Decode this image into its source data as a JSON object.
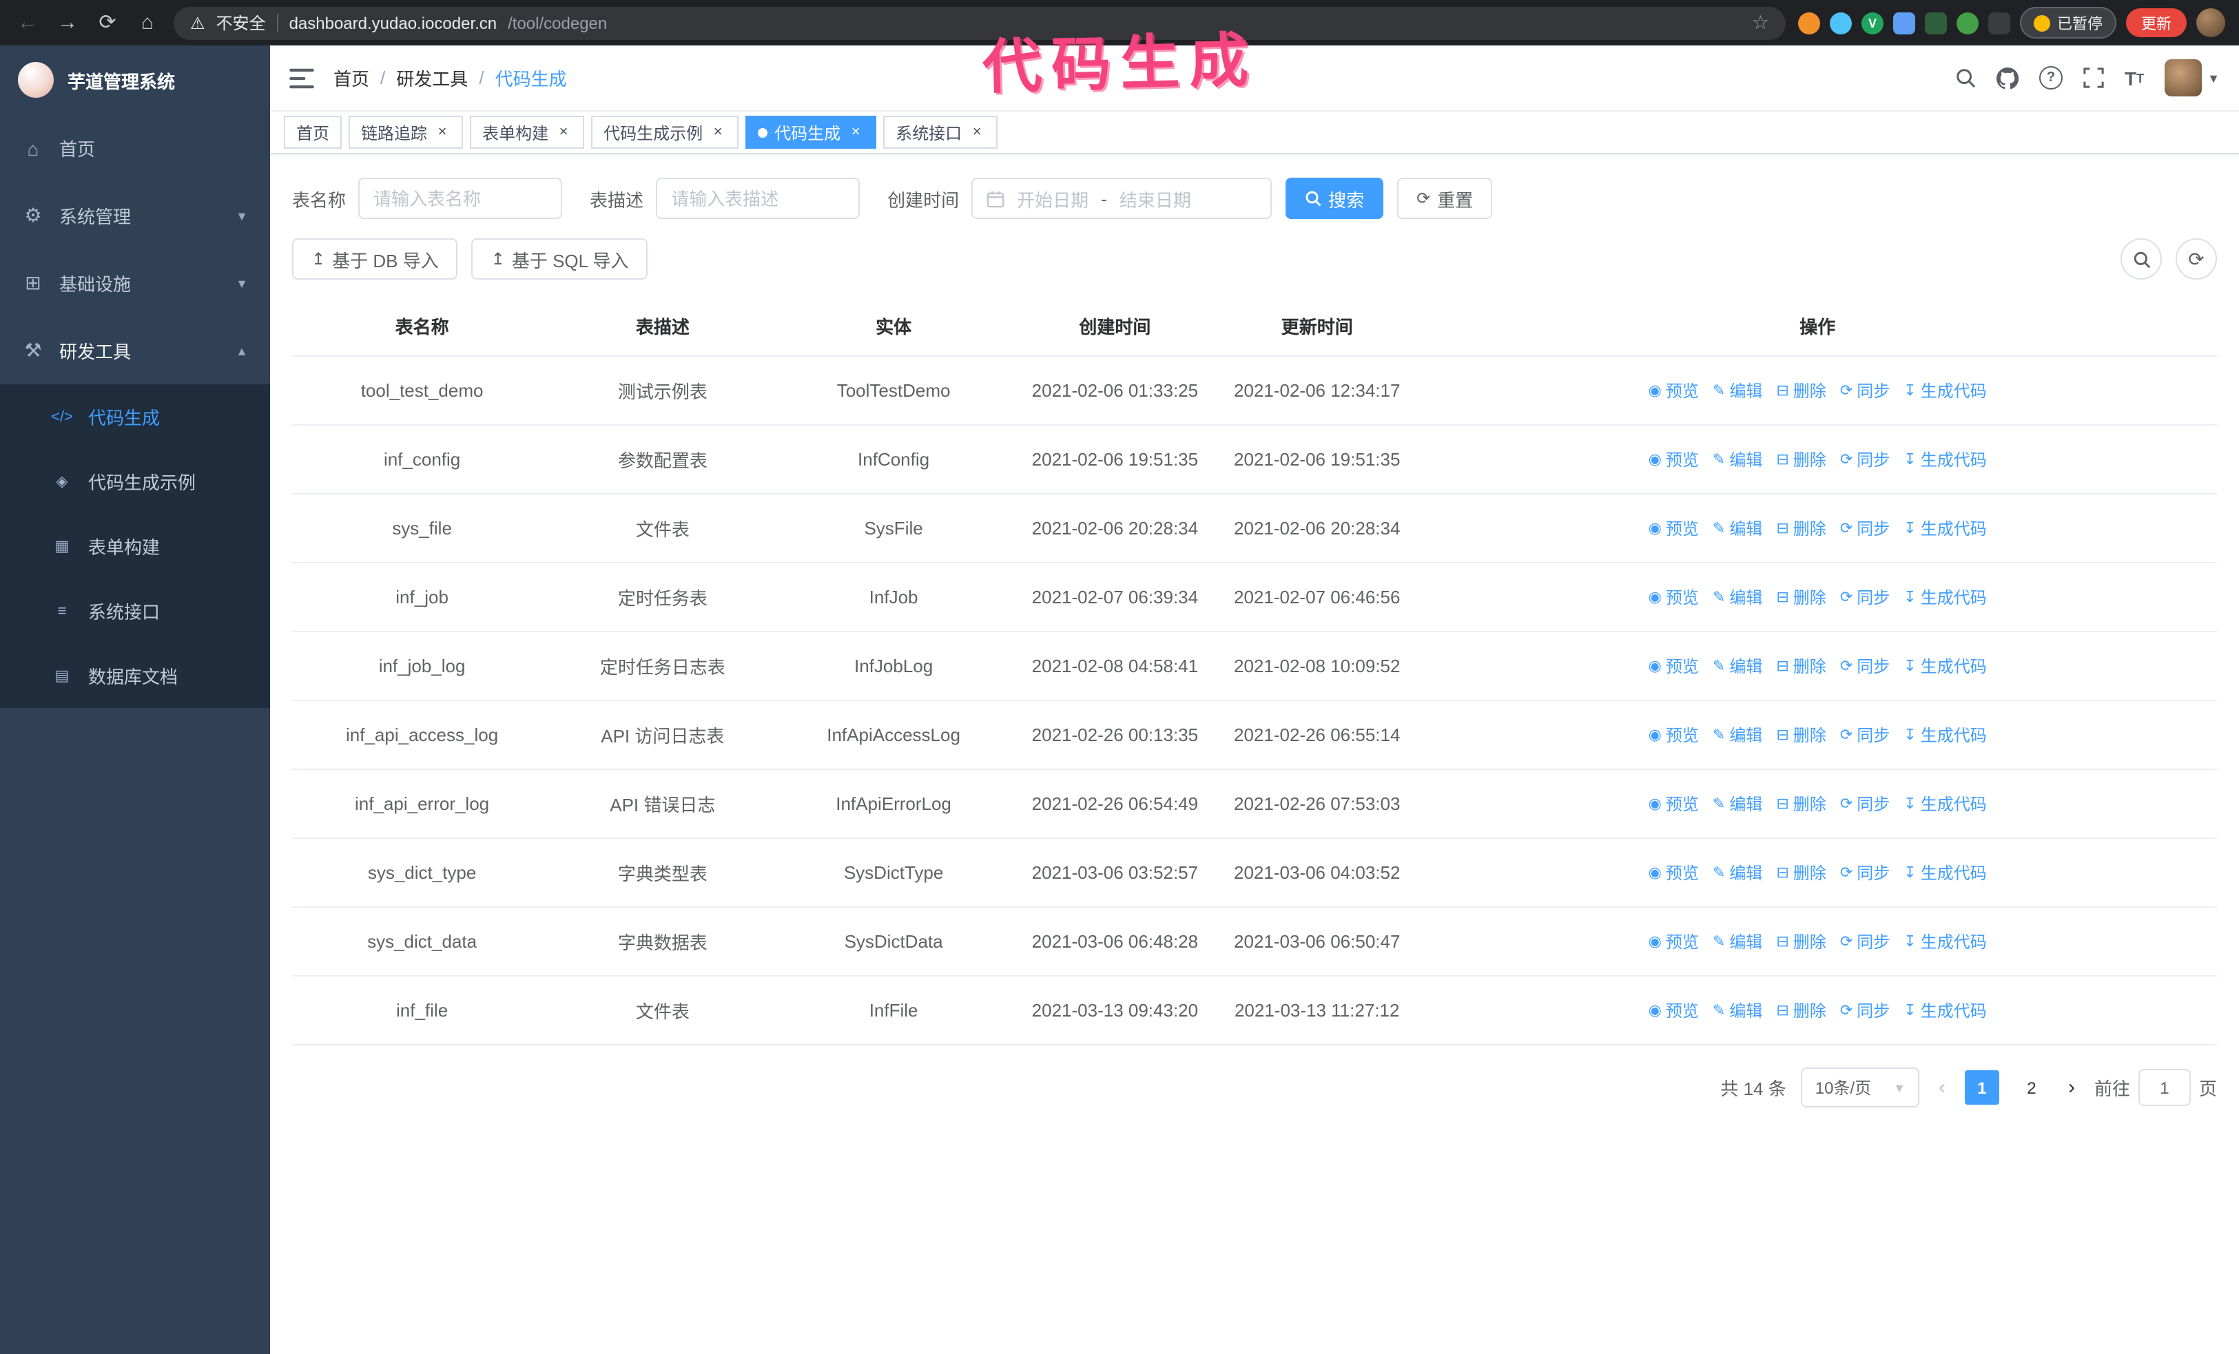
{
  "annotation": {
    "text": "代码生成",
    "color": "#f5437e"
  },
  "browser": {
    "insecure_label": "不安全",
    "url_host": "dashboard.yudao.iocoder.cn",
    "url_path": "/tool/codegen",
    "extension_badge_v": "V",
    "paused_badge": "已暂停",
    "update_button": "更新"
  },
  "sidebar": {
    "app_title": "芋道管理系统",
    "items": [
      {
        "label": "首页",
        "icon": "home-icon"
      },
      {
        "label": "系统管理",
        "icon": "gear-icon"
      },
      {
        "label": "基础设施",
        "icon": "infrastructure-icon"
      },
      {
        "label": "研发工具",
        "icon": "tools-icon"
      }
    ],
    "submenu": [
      {
        "label": "代码生成",
        "icon": "code-icon",
        "active": true
      },
      {
        "label": "代码生成示例",
        "icon": "example-icon"
      },
      {
        "label": "表单构建",
        "icon": "form-icon"
      },
      {
        "label": "系统接口",
        "icon": "api-icon"
      },
      {
        "label": "数据库文档",
        "icon": "database-icon"
      }
    ]
  },
  "header": {
    "breadcrumb": [
      "首页",
      "研发工具",
      "代码生成"
    ],
    "separator": "/"
  },
  "tabs": [
    {
      "label": "首页",
      "closable": false
    },
    {
      "label": "链路追踪",
      "closable": true
    },
    {
      "label": "表单构建",
      "closable": true
    },
    {
      "label": "代码生成示例",
      "closable": true
    },
    {
      "label": "代码生成",
      "closable": true,
      "active": true
    },
    {
      "label": "系统接口",
      "closable": true
    }
  ],
  "filters": {
    "table_name_label": "表名称",
    "table_name_placeholder": "请输入表名称",
    "table_desc_label": "表描述",
    "table_desc_placeholder": "请输入表描述",
    "create_time_label": "创建时间",
    "date_start_placeholder": "开始日期",
    "date_separator": "-",
    "date_end_placeholder": "结束日期",
    "search_button": "搜索",
    "reset_button": "重置"
  },
  "toolbar": {
    "import_db_button": "基于 DB 导入",
    "import_sql_button": "基于 SQL 导入"
  },
  "table": {
    "columns": [
      "表名称",
      "表描述",
      "实体",
      "创建时间",
      "更新时间",
      "操作"
    ],
    "actions": [
      "预览",
      "编辑",
      "删除",
      "同步",
      "生成代码"
    ],
    "action_icons": [
      "eye-icon",
      "pencil-icon",
      "trash-icon",
      "sync-icon",
      "download-icon"
    ],
    "rows": [
      {
        "name": "tool_test_demo",
        "desc": "测试示例表",
        "entity": "ToolTestDemo",
        "created": "2021-02-06 01:33:25",
        "updated": "2021-02-06 12:34:17"
      },
      {
        "name": "inf_config",
        "desc": "参数配置表",
        "entity": "InfConfig",
        "created": "2021-02-06 19:51:35",
        "updated": "2021-02-06 19:51:35"
      },
      {
        "name": "sys_file",
        "desc": "文件表",
        "entity": "SysFile",
        "created": "2021-02-06 20:28:34",
        "updated": "2021-02-06 20:28:34"
      },
      {
        "name": "inf_job",
        "desc": "定时任务表",
        "entity": "InfJob",
        "created": "2021-02-07 06:39:34",
        "updated": "2021-02-07 06:46:56"
      },
      {
        "name": "inf_job_log",
        "desc": "定时任务日志表",
        "entity": "InfJobLog",
        "created": "2021-02-08 04:58:41",
        "updated": "2021-02-08 10:09:52"
      },
      {
        "name": "inf_api_access_log",
        "desc": "API 访问日志表",
        "entity": "InfApiAccessLog",
        "created": "2021-02-26 00:13:35",
        "updated": "2021-02-26 06:55:14"
      },
      {
        "name": "inf_api_error_log",
        "desc": "API 错误日志",
        "entity": "InfApiErrorLog",
        "created": "2021-02-26 06:54:49",
        "updated": "2021-02-26 07:53:03"
      },
      {
        "name": "sys_dict_type",
        "desc": "字典类型表",
        "entity": "SysDictType",
        "created": "2021-03-06 03:52:57",
        "updated": "2021-03-06 04:03:52"
      },
      {
        "name": "sys_dict_data",
        "desc": "字典数据表",
        "entity": "SysDictData",
        "created": "2021-03-06 06:48:28",
        "updated": "2021-03-06 06:50:47"
      },
      {
        "name": "inf_file",
        "desc": "文件表",
        "entity": "InfFile",
        "created": "2021-03-13 09:43:20",
        "updated": "2021-03-13 11:27:12"
      }
    ]
  },
  "pagination": {
    "total": "共 14 条",
    "page_size": "10条/页",
    "prev": "‹",
    "next": "›",
    "pages": [
      "1",
      "2"
    ],
    "current": "1",
    "goto_label": "前往",
    "goto_value": "1",
    "goto_suffix": "页"
  },
  "colors": {
    "accent": "#409eff",
    "sidebar_bg": "#304156",
    "submenu_bg": "#1f2d3d",
    "annotation": "#f5437e"
  }
}
